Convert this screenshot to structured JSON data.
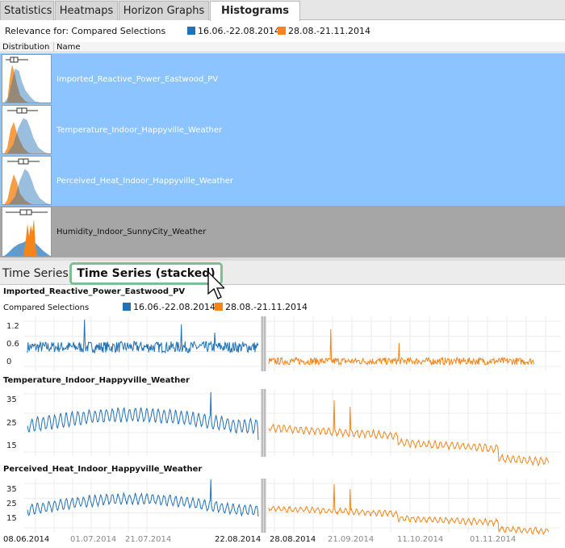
{
  "top_tabs": [
    "Statistics",
    "Heatmaps",
    "Horizon Graphs",
    "Histograms"
  ],
  "relevance_label": "Relevance for: Compared Selections",
  "legend": [
    {
      "label": "16.06.-22.08.2014",
      "color": "#2171b5"
    },
    {
      "label": "28.08.-21.11.2014",
      "color": "#f58518"
    }
  ],
  "table": {
    "col_distribution": "Distribution",
    "col_name": "Name",
    "rows": [
      {
        "name": "Imported_Reactive_Power_Eastwood_PV",
        "selected": true
      },
      {
        "name": "Temperature_Indoor_Happyville_Weather",
        "selected": true
      },
      {
        "name": "Perceived_Heat_Indoor_Happyville_Weather",
        "selected": true
      },
      {
        "name": "Humidity_Indoor_SunnyCity_Weather",
        "selected": false
      }
    ]
  },
  "bottom_tabs": [
    "Time Series",
    "Time Series (stacked)"
  ],
  "compared_label": "Compared Selections",
  "colors": {
    "selection": "#8cc4ff",
    "unselected": "#a6a6a6",
    "series1": "#2171b5",
    "series2": "#f58518",
    "highlight": "#7dbf93"
  },
  "charts": [
    {
      "title": "Imported_Reactive_Power_Eastwood_PV",
      "yticks": [
        "1.2",
        "0.6",
        "0"
      ]
    },
    {
      "title": "Temperature_Indoor_Happyville_Weather",
      "yticks": [
        "35",
        "25",
        "15"
      ]
    },
    {
      "title": "Perceived_Heat_Indoor_Happyville_Weather",
      "yticks": [
        "35",
        "25",
        "15"
      ]
    }
  ],
  "x_labels_left": [
    "08.06.2014",
    "01.07.2014",
    "21.07.2014",
    "22.08.2014"
  ],
  "x_labels_right": [
    "28.08.2014",
    "21.09.2014",
    "11.10.2014",
    "01.11.2014"
  ]
}
